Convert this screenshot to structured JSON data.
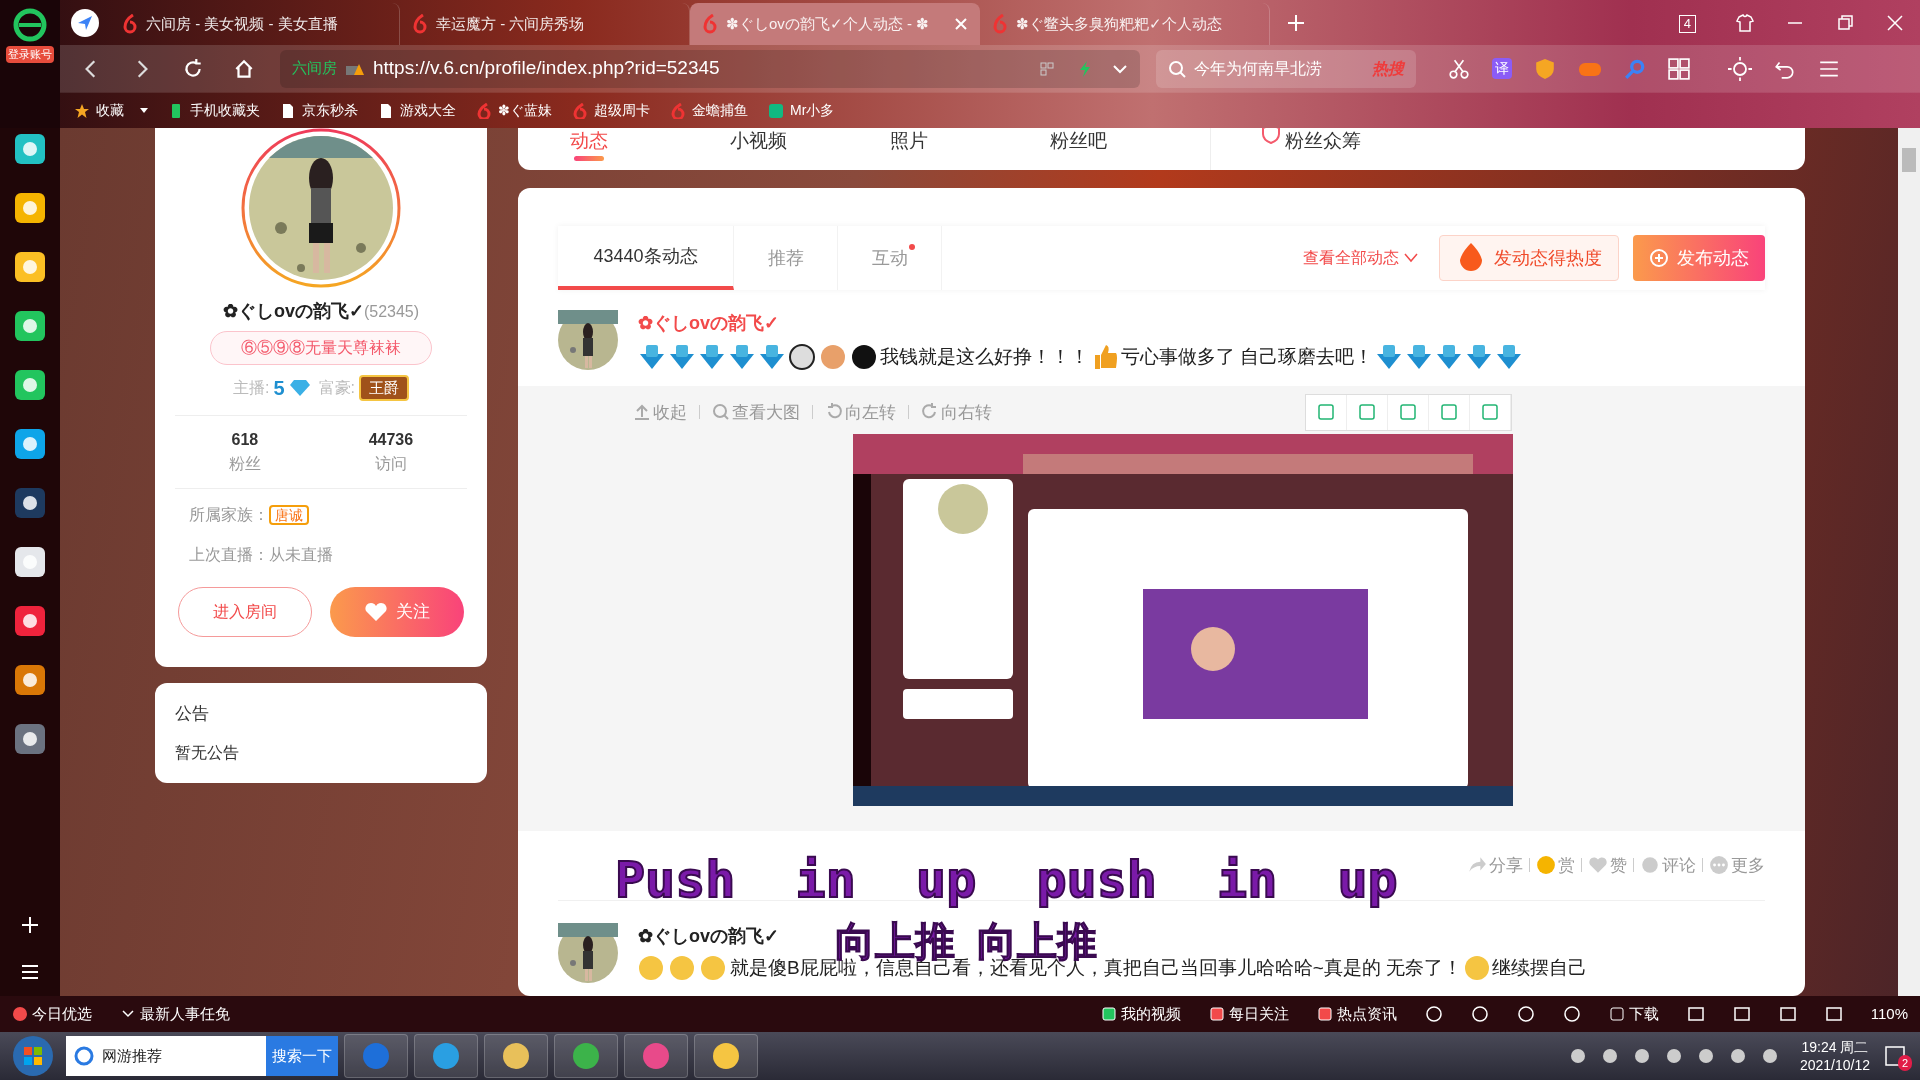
{
  "browser": {
    "side_login": "登录账号",
    "tabs": [
      {
        "title": "六间房 - 美女视频 - 美女直播",
        "selected": false
      },
      {
        "title": "幸运魔方 - 六间房秀场",
        "selected": false
      },
      {
        "title": "✽ぐしovの韵飞✓个人动态 - ✽",
        "selected": true
      },
      {
        "title": "✽ぐ鳖头多臭狗粑粑✓个人动态",
        "selected": false
      }
    ],
    "tab_count": "4",
    "address": {
      "site": "六间房",
      "url": "https://v.6.cn/profile/index.php?rid=52345"
    },
    "search": {
      "value": "今年为何南旱北涝",
      "hot": "热搜"
    },
    "translate": "译",
    "bookmarks": [
      "收藏",
      "手机收藏夹",
      "京东秒杀",
      "游戏大全",
      "✽ぐ蓝妹",
      "超级周卡",
      "金蟾捕鱼",
      "Mr小多"
    ]
  },
  "profile": {
    "name": "✿ぐしovの韵飞✓",
    "id": "(52345)",
    "tag": "⑥⑤⑨⑧无量天尊袜袜",
    "host_label": "主播:",
    "host_level": "5",
    "rich_label": "富豪:",
    "rich_badge": "王爵",
    "stats": [
      {
        "value": "618",
        "label": "粉丝"
      },
      {
        "value": "44736",
        "label": "访问"
      }
    ],
    "family_label": "所属家族：",
    "family": "唐诚",
    "last_live": "上次直播：从未直播",
    "enter_button": "进入房间",
    "follow_button": "关注"
  },
  "notice": {
    "title": "公告",
    "text": "暂无公告"
  },
  "nav_tabs": [
    {
      "label": "动态",
      "selected": true
    },
    {
      "label": "小视频",
      "selected": false
    },
    {
      "label": "照片",
      "selected": false
    },
    {
      "label": "粉丝吧",
      "selected": false
    },
    {
      "label": "粉丝众筹",
      "selected": false
    }
  ],
  "feed": {
    "tabs": [
      {
        "label": "43440条动态",
        "selected": true,
        "dot": false
      },
      {
        "label": "推荐",
        "selected": false,
        "dot": false
      },
      {
        "label": "互动",
        "selected": false,
        "dot": true
      }
    ],
    "view_all": "查看全部动态",
    "hot_button": "发动态得热度",
    "publish_button": "发布动态",
    "posts": [
      {
        "author": "✿ぐしovの韵飞✓",
        "text": "我钱就是这么好挣！！！",
        "text2": "亏心事做多了 自己琢磨去吧！",
        "tools": [
          "收起",
          "查看大图",
          "向左转",
          "向右转"
        ],
        "image": {
          "kind": "picture"
        },
        "actions": [
          "分享",
          "赏",
          "赞",
          "评论",
          "更多"
        ]
      },
      {
        "author": "✿ぐしovの韵飞✓",
        "text": "就是傻B屁屁啦，信息自己看，还看见个人，真把自己当回事儿哈哈哈~真是的 无奈了！",
        "text2": "继续摆自己"
      }
    ]
  },
  "captions": [
    "Push  in  up  push  in  up",
    "向上推  向上推"
  ],
  "status_bar": {
    "left": [
      "今日优选",
      "最新人事任免"
    ],
    "right": [
      "我的视频",
      "每日关注",
      "热点资讯",
      "下载"
    ],
    "zoom": "110%"
  },
  "taskbar": {
    "search_value": "网游推荐",
    "search_button": "搜索一下",
    "time": "19:24 周二",
    "date": "2021/10/12",
    "badge": "2"
  }
}
